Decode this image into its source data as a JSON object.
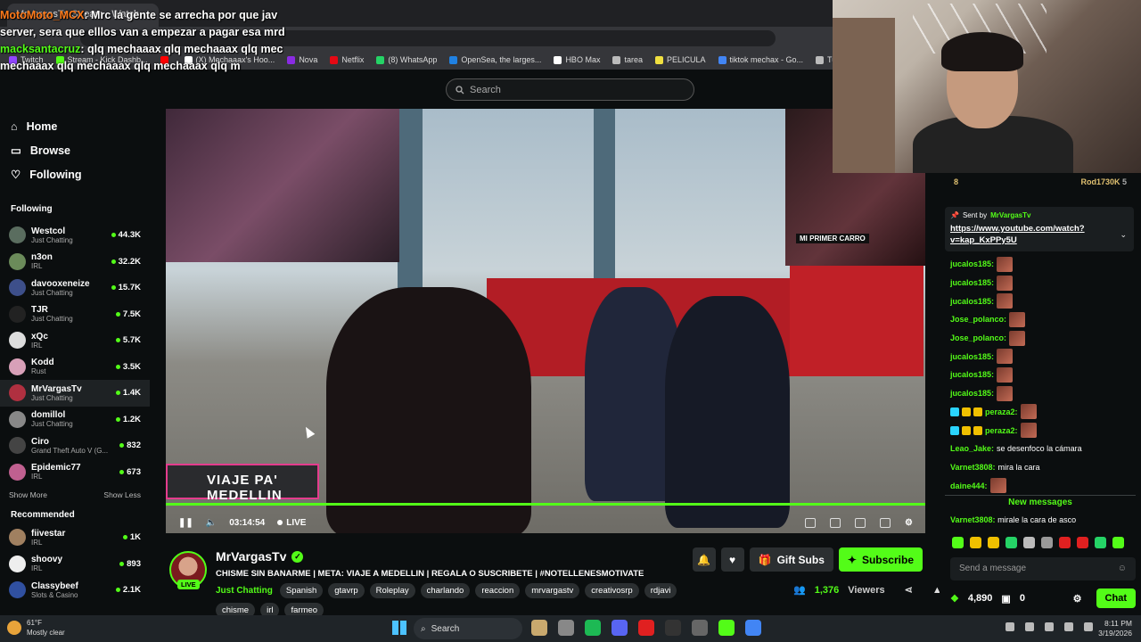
{
  "overlay_chat": [
    {
      "user": "MotoMoto_MCX",
      "text": ": Mrc la gente se arrecha por que jav server, sera que elllos van a empezar a pagar esa mrd",
      "color": "#ff7a1a"
    },
    {
      "user": "macksantacruz",
      "text": ": qlq mechaaax qlq mechaaax qlq mec mechaaax qlq mechaaax qlq mechaaax qlq m",
      "color": "#53fc18"
    }
  ],
  "browser": {
    "tab_title": "MrVargasTv Stream - Watch",
    "bookmarks": [
      {
        "label": "Twitch",
        "color": "#9146ff"
      },
      {
        "label": "Stream - Kick Dashb...",
        "color": "#53fc18"
      },
      {
        "label": "",
        "color": "#ff0000"
      },
      {
        "label": "(X) Mechaaax's Hoo...",
        "color": "#ffffff"
      },
      {
        "label": "Nova",
        "color": "#8a2be2"
      },
      {
        "label": "Netflix",
        "color": "#e50914"
      },
      {
        "label": "(8) WhatsApp",
        "color": "#25d366"
      },
      {
        "label": "OpenSea, the larges...",
        "color": "#2081e2"
      },
      {
        "label": "HBO Max",
        "color": "#ffffff"
      },
      {
        "label": "tarea",
        "color": "#bbbbbb"
      },
      {
        "label": "PELICULA",
        "color": "#f0e040"
      },
      {
        "label": "tiktok mechax - Go...",
        "color": "#4285f4"
      },
      {
        "label": "Turn You",
        "color": "#bbbbbb"
      }
    ]
  },
  "header": {
    "search_placeholder": "Search"
  },
  "sidebar": {
    "nav": [
      {
        "label": "Home",
        "icon": "home-icon"
      },
      {
        "label": "Browse",
        "icon": "browse-icon"
      },
      {
        "label": "Following",
        "icon": "heart-icon"
      }
    ],
    "following_title": "Following",
    "following": [
      {
        "name": "Westcol",
        "category": "Just Chatting",
        "viewers": "44.3K",
        "color": "#5a6d5f"
      },
      {
        "name": "n3on",
        "category": "IRL",
        "viewers": "32.2K",
        "color": "#6b8b5a"
      },
      {
        "name": "davooxeneize",
        "category": "Just Chatting",
        "viewers": "15.7K",
        "color": "#3d4f8a"
      },
      {
        "name": "TJR",
        "category": "Just Chatting",
        "viewers": "7.5K",
        "color": "#222222"
      },
      {
        "name": "xQc",
        "category": "IRL",
        "viewers": "5.7K",
        "color": "#dddddd"
      },
      {
        "name": "Kodd",
        "category": "Rust",
        "viewers": "3.5K",
        "color": "#d8a0b8"
      },
      {
        "name": "MrVargasTv",
        "category": "Just Chatting",
        "viewers": "1.4K",
        "color": "#b03040"
      },
      {
        "name": "domillol",
        "category": "Just Chatting",
        "viewers": "1.2K",
        "color": "#888888"
      },
      {
        "name": "Ciro",
        "category": "Grand Theft Auto V (G...",
        "viewers": "832",
        "color": "#444444"
      },
      {
        "name": "Epidemic77",
        "category": "IRL",
        "viewers": "673",
        "color": "#c06090"
      }
    ],
    "show_more": "Show More",
    "show_less": "Show Less",
    "recommended_title": "Recommended",
    "recommended": [
      {
        "name": "fiivestar",
        "category": "IRL",
        "viewers": "1K",
        "color": "#a08060"
      },
      {
        "name": "shoovy",
        "category": "IRL",
        "viewers": "893",
        "color": "#eeeeee"
      },
      {
        "name": "Classybeef",
        "category": "Slots & Casino",
        "viewers": "2.1K",
        "color": "#3050a0"
      }
    ]
  },
  "player": {
    "time": "03:14:54",
    "live_label": "LIVE",
    "banner_text": "VIAJE PA' MEDELLIN",
    "cam_label": "MI PRIMER CARRO"
  },
  "stream": {
    "channel": "MrVargasTv",
    "live_badge": "LIVE",
    "title": "CHISME SIN BANARME | META: VIAJE A MEDELLIN | REGALA O SUSCRIBETE | #NOTELLENESMOTIVATE",
    "category": "Just Chatting",
    "tags": [
      "Spanish",
      "gtavrp",
      "Roleplay",
      "charlando",
      "reaccion",
      "mrvargastv",
      "creativosrp",
      "rdjavi",
      "chisme",
      "irl",
      "farmeo"
    ],
    "gift_label": "Gift Subs",
    "subscribe_label": "Subscribe",
    "viewers": "1,376",
    "viewers_label": "Viewers"
  },
  "chat": {
    "top_left_count": "8",
    "top_user": "Rod1730K",
    "top_count": "5",
    "pinned_sent_by": "Sent by",
    "pinned_user": "MrVargasTv",
    "pinned_link": "https://www.youtube.com/watch?v=kap_KxPPy5U",
    "messages": [
      {
        "user": "jucalos185:",
        "text": "",
        "emote": true,
        "badges": 0
      },
      {
        "user": "jucalos185:",
        "text": "",
        "emote": true,
        "badges": 0
      },
      {
        "user": "jucalos185:",
        "text": "",
        "emote": true,
        "badges": 0
      },
      {
        "user": "Jose_polanco:",
        "text": "",
        "emote": true,
        "badges": 0
      },
      {
        "user": "Jose_polanco:",
        "text": "",
        "emote": true,
        "badges": 0
      },
      {
        "user": "jucalos185:",
        "text": "",
        "emote": true,
        "badges": 0
      },
      {
        "user": "jucalos185:",
        "text": "",
        "emote": true,
        "badges": 0
      },
      {
        "user": "jucalos185:",
        "text": "",
        "emote": true,
        "badges": 0
      },
      {
        "user": "peraza2:",
        "text": "",
        "emote": true,
        "badges": 3
      },
      {
        "user": "peraza2:",
        "text": "",
        "emote": true,
        "badges": 3
      },
      {
        "user": "Leao_Jake:",
        "text": "se desenfoco la cámara",
        "emote": false,
        "badges": 0
      },
      {
        "user": "Varnet3808:",
        "text": "mira la cara",
        "emote": false,
        "badges": 0
      },
      {
        "user": "daine444:",
        "text": "",
        "emote": true,
        "badges": 0
      }
    ],
    "new_messages": "New messages",
    "last_user": "Varnet3808:",
    "last_text": "mirale la cara de asco",
    "input_placeholder": "Send a message",
    "points": "4,890",
    "zero": "0",
    "chat_button": "Chat",
    "emote_colors": [
      "#53fc18",
      "#f0c000",
      "#f0c000",
      "#25d366",
      "#bbbbbb",
      "#999999",
      "#e02020",
      "#e02020",
      "#25d366",
      "#53fc18"
    ]
  },
  "taskbar": {
    "temp": "61°F",
    "weather": "Mostly clear",
    "search": "Search",
    "time": "8:11 PM",
    "date": "3/19/2026",
    "app_colors": [
      "#c9a96e",
      "#888888",
      "#1db954",
      "#5865f2",
      "#e02020",
      "#333333",
      "#666666",
      "#53fc18",
      "#4285f4"
    ]
  }
}
